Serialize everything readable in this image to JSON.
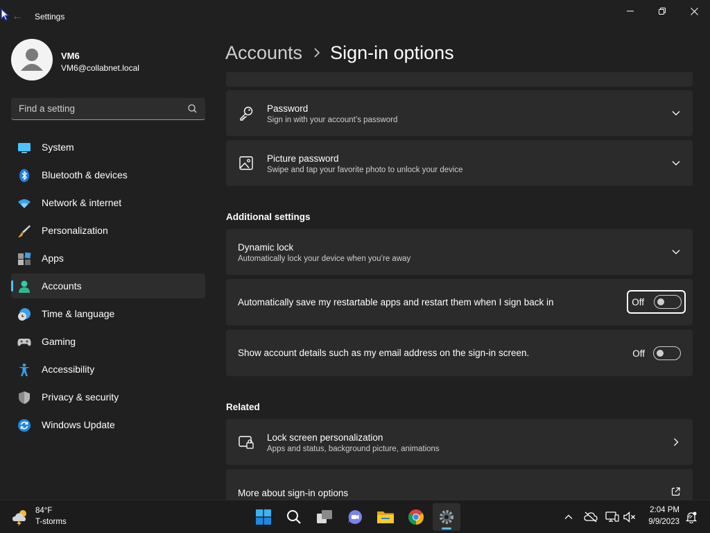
{
  "window": {
    "title": "Settings"
  },
  "user": {
    "name": "VM6",
    "email": "VM6@collabnet.local"
  },
  "search": {
    "placeholder": "Find a setting"
  },
  "sidebar": {
    "items": [
      {
        "label": "System",
        "icon": "system-icon"
      },
      {
        "label": "Bluetooth & devices",
        "icon": "bluetooth-icon"
      },
      {
        "label": "Network & internet",
        "icon": "wifi-icon"
      },
      {
        "label": "Personalization",
        "icon": "brush-icon"
      },
      {
        "label": "Apps",
        "icon": "apps-icon"
      },
      {
        "label": "Accounts",
        "icon": "accounts-icon",
        "selected": true
      },
      {
        "label": "Time & language",
        "icon": "globe-clock-icon"
      },
      {
        "label": "Gaming",
        "icon": "gamepad-icon"
      },
      {
        "label": "Accessibility",
        "icon": "accessibility-icon"
      },
      {
        "label": "Privacy & security",
        "icon": "shield-icon"
      },
      {
        "label": "Windows Update",
        "icon": "update-icon"
      }
    ]
  },
  "header": {
    "parent": "Accounts",
    "current": "Sign-in options"
  },
  "sign_in_methods": [
    {
      "title": "Password",
      "subtitle": "Sign in with your account’s password",
      "icon": "key-icon"
    },
    {
      "title": "Picture password",
      "subtitle": "Swipe and tap your favorite photo to unlock your device",
      "icon": "picture-icon"
    }
  ],
  "additional": {
    "heading": "Additional settings",
    "dynamic_lock": {
      "title": "Dynamic lock",
      "subtitle": "Automatically lock your device when you’re away"
    },
    "restart_apps": {
      "label": "Automatically save my restartable apps and restart them when I sign back in",
      "state": "Off",
      "on": false
    },
    "account_details": {
      "label": "Show account details such as my email address on the sign-in screen.",
      "state": "Off",
      "on": false
    }
  },
  "related": {
    "heading": "Related",
    "lock_screen": {
      "title": "Lock screen personalization",
      "subtitle": "Apps and status, background picture, animations"
    },
    "more_about": {
      "title": "More about sign-in options"
    }
  },
  "taskbar": {
    "weather_temp": "84°F",
    "weather_desc": "T-storms",
    "time": "2:04 PM",
    "date": "9/9/2023",
    "apps": [
      "start-icon",
      "search-icon",
      "task-view-icon",
      "teams-chat-icon",
      "file-explorer-icon",
      "chrome-icon",
      "settings-icon"
    ]
  },
  "colors": {
    "accent": "#4cc2ff",
    "background": "#202020",
    "card": "#2b2b2b",
    "taskbar": "#1c1c1c"
  }
}
